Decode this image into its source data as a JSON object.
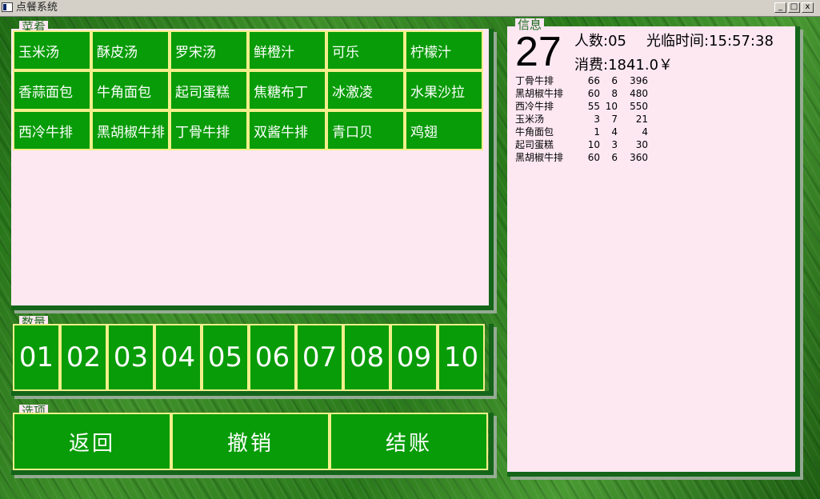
{
  "window": {
    "title": "点餐系统",
    "min_label": "_",
    "max_label": "□",
    "close_label": "x"
  },
  "menu": {
    "label": "菜肴",
    "items": [
      "玉米汤",
      "酥皮汤",
      "罗宋汤",
      "鲜橙汁",
      "可乐",
      "柠檬汁",
      "香蒜面包",
      "牛角面包",
      "起司蛋糕",
      "焦糖布丁",
      "冰激凌",
      "水果沙拉",
      "西冷牛排",
      "黑胡椒牛排",
      "丁骨牛排",
      "双酱牛排",
      "青口贝",
      "鸡翅"
    ]
  },
  "quantity": {
    "label": "数量",
    "items": [
      "01",
      "02",
      "03",
      "04",
      "05",
      "06",
      "07",
      "08",
      "09",
      "10"
    ]
  },
  "options": {
    "label": "选项",
    "return": "返回",
    "undo": "撤销",
    "checkout": "结账"
  },
  "info": {
    "label": "信息",
    "table_number": "27",
    "people": "人数:05",
    "time": "光临时间:15:57:38",
    "total": "消费:1841.0￥",
    "orders": [
      {
        "name": "丁骨牛排",
        "price": "66",
        "qty": "6",
        "subtotal": "396"
      },
      {
        "name": "黑胡椒牛排",
        "price": "60",
        "qty": "8",
        "subtotal": "480"
      },
      {
        "name": "西冷牛排",
        "price": "55",
        "qty": "10",
        "subtotal": "550"
      },
      {
        "name": "玉米汤",
        "price": "3",
        "qty": "7",
        "subtotal": "21"
      },
      {
        "name": "牛角面包",
        "price": "1",
        "qty": "4",
        "subtotal": "4"
      },
      {
        "name": "起司蛋糕",
        "price": "10",
        "qty": "3",
        "subtotal": "30"
      },
      {
        "name": "黑胡椒牛排",
        "price": "60",
        "qty": "6",
        "subtotal": "360"
      }
    ]
  },
  "colors": {
    "button_green": "#089c08",
    "button_border": "#f3ef8a",
    "panel_pink": "#fde8f2",
    "frame_green": "#14651a"
  }
}
